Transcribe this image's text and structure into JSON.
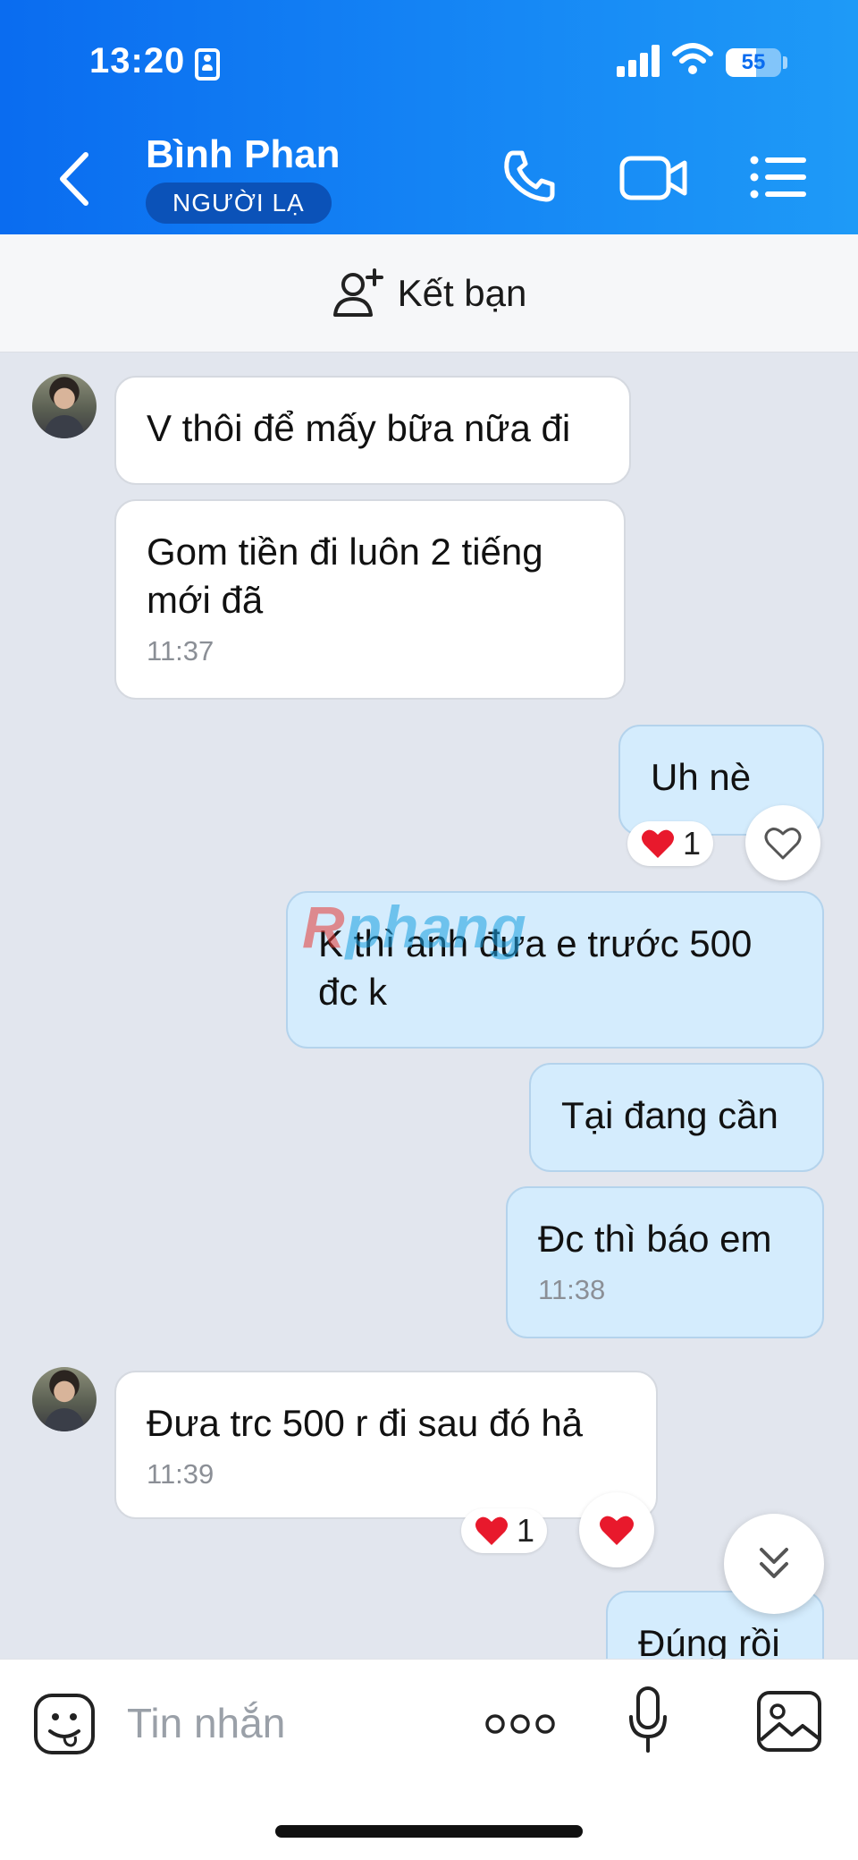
{
  "status_bar": {
    "time": "13:20",
    "battery": "55",
    "battery_level": 0.55
  },
  "header": {
    "contact_name": "Bình Phan",
    "badge": "NGƯỜI LẠ",
    "icons": [
      "back-chevron-icon",
      "phone-icon",
      "video-camera-icon",
      "list-menu-icon"
    ]
  },
  "add_friend": {
    "label": "Kết bạn",
    "icon": "add-user-icon"
  },
  "messages": [
    {
      "side": "incoming",
      "text": "V thôi để mấy bữa nữa đi"
    },
    {
      "side": "incoming",
      "text": "Gom tiền đi luôn 2 tiếng mới đã",
      "time": "11:37"
    },
    {
      "side": "outgoing",
      "text": "Uh nè",
      "reaction": {
        "emoji": "heart",
        "count": "1"
      }
    },
    {
      "side": "outgoing",
      "text": "K thì anh đưa e trước 500 đc k"
    },
    {
      "side": "outgoing",
      "text": "Tại đang cần"
    },
    {
      "side": "outgoing",
      "text": "Đc thì báo em",
      "time": "11:38"
    },
    {
      "side": "incoming",
      "text": "Đưa trc 500 r đi sau đó hả",
      "time": "11:39",
      "reaction": {
        "emoji": "heart",
        "count": "1"
      }
    },
    {
      "side": "outgoing",
      "text": "Đúng rồi"
    }
  ],
  "watermark": {
    "r": "R",
    "rest": "phang"
  },
  "input_bar": {
    "placeholder": "Tin nhắn",
    "icons": [
      "sticker-icon",
      "more-icon",
      "microphone-icon",
      "image-icon"
    ]
  },
  "colors": {
    "header_start": "#0a6cf0",
    "header_end": "#1e9af7",
    "incoming_bubble": "#ffffff",
    "outgoing_bubble": "#d4ecfd",
    "chat_background": "#e2e6ee",
    "heart": "#e8192c"
  }
}
